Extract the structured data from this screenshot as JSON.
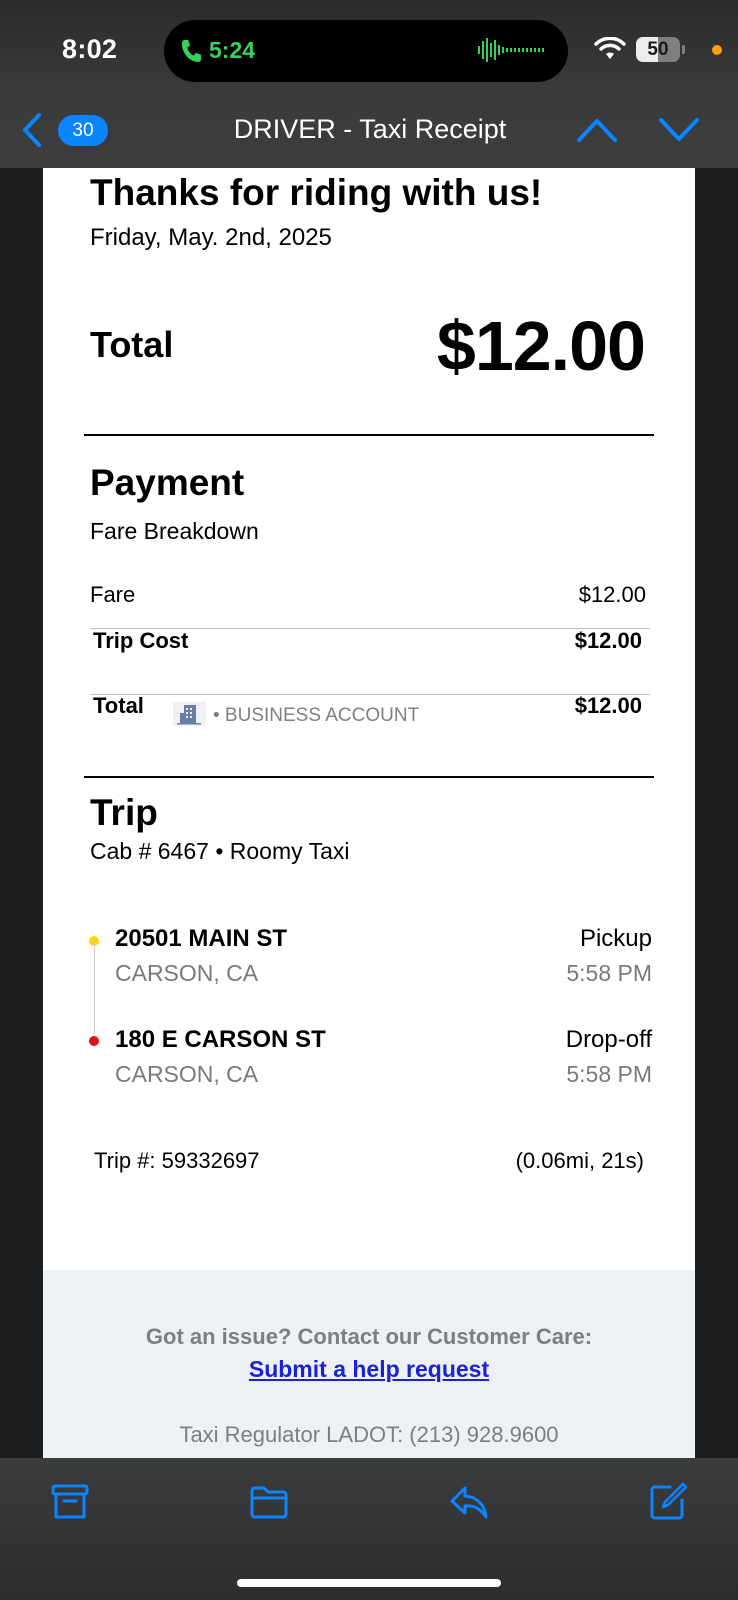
{
  "status_bar": {
    "time": "8:02",
    "call_time": "5:24",
    "battery_percent": "50",
    "battery_level": 0.5
  },
  "nav": {
    "unread_count": "30",
    "title": "DRIVER - Taxi Receipt"
  },
  "receipt": {
    "heading": "Thanks for riding with us!",
    "date": "Friday, May. 2nd, 2025",
    "total_label": "Total",
    "total_amount": "$12.00",
    "payment": {
      "heading": "Payment",
      "subheading": "Fare Breakdown",
      "rows": [
        {
          "label": "Fare",
          "value": "$12.00"
        },
        {
          "label": "Trip Cost",
          "value": "$12.00"
        },
        {
          "label": "Total",
          "value": "$12.00",
          "account": "• BUSINESS ACCOUNT"
        }
      ]
    },
    "trip": {
      "heading": "Trip",
      "cab_info": "Cab # 6467 • Roomy Taxi",
      "pickup": {
        "address": "20501 MAIN ST",
        "city": "CARSON, CA",
        "label": "Pickup",
        "time": "5:58 PM"
      },
      "dropoff": {
        "address": "180 E CARSON ST",
        "city": "CARSON, CA",
        "label": "Drop-off",
        "time": "5:58 PM"
      },
      "trip_number": "Trip #: 59332697",
      "distance_duration": "(0.06mi, 21s)"
    },
    "footer": {
      "issue_text": "Got an issue? Contact our Customer Care:",
      "help_link": "Submit a help request",
      "regulator": "Taxi Regulator LADOT: (213) 928.9600"
    }
  },
  "colors": {
    "accent": "#0a84ff",
    "call_green": "#35d158",
    "pickup_dot": "#ffd60a",
    "dropoff_dot": "#e0101a",
    "link": "#1a21d6"
  },
  "icons": {
    "toolbar": [
      "archive-icon",
      "folder-icon",
      "reply-icon",
      "compose-icon"
    ]
  }
}
